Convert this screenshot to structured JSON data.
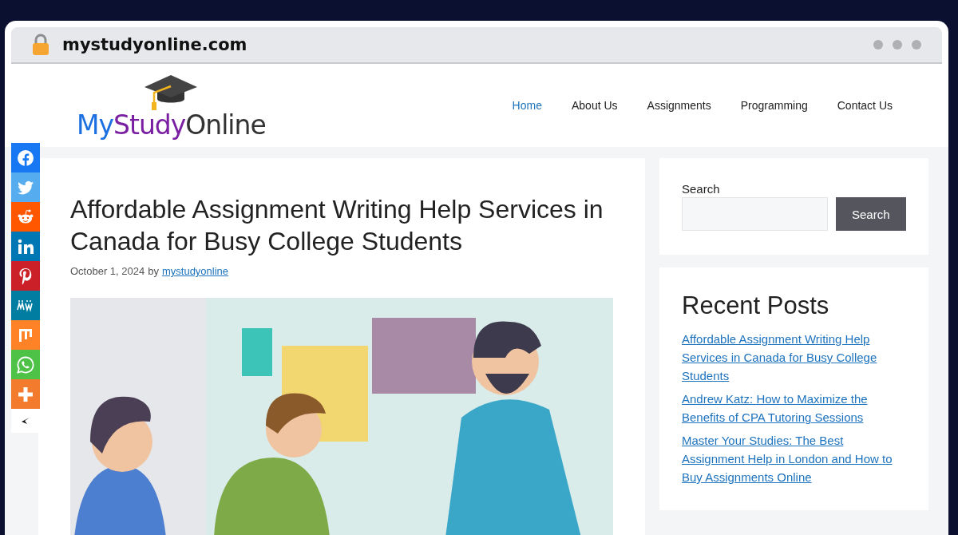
{
  "browser": {
    "address": "mystudyonline.com"
  },
  "logo": {
    "parts": [
      {
        "text": "My",
        "color": "#1b6fe0"
      },
      {
        "text": "Study",
        "color": "#7a1fa2"
      },
      {
        "text": "Online",
        "color": "#333333"
      }
    ]
  },
  "nav": [
    {
      "label": "Home",
      "selected": true
    },
    {
      "label": "About Us",
      "selected": false
    },
    {
      "label": "Assignments",
      "selected": false
    },
    {
      "label": "Programming",
      "selected": false
    },
    {
      "label": "Contact Us",
      "selected": false
    }
  ],
  "share_bar": [
    {
      "kind": "facebook",
      "color": "#1877f2"
    },
    {
      "kind": "twitter",
      "color": "#55acee"
    },
    {
      "kind": "reddit",
      "color": "#ff5700"
    },
    {
      "kind": "linkedin",
      "color": "#0077b5"
    },
    {
      "kind": "pinterest",
      "color": "#cb2027"
    },
    {
      "kind": "mewe",
      "color": "#007da1"
    },
    {
      "kind": "mix",
      "color": "#ff8226"
    },
    {
      "kind": "whatsapp",
      "color": "#4dc247"
    },
    {
      "kind": "more",
      "color": "#f27b2d"
    }
  ],
  "article": {
    "title": "Affordable Assignment Writing Help Services in Canada for Busy College Students",
    "date": "October 1, 2024",
    "by": "by",
    "author": "mystudyonline"
  },
  "sidebar": {
    "search_label": "Search",
    "search_button": "Search",
    "recent_title": "Recent Posts",
    "recent_posts": [
      "Affordable Assignment Writing Help Services in Canada for Busy College Students",
      "Andrew Katz: How to Maximize the Benefits of CPA Tutoring Sessions",
      "Master Your Studies: The Best Assignment Help in London and How to Buy Assignments Online"
    ]
  }
}
